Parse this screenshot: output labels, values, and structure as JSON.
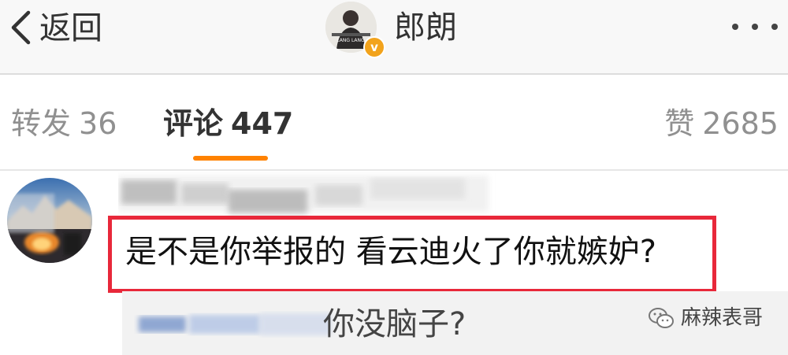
{
  "navbar": {
    "back_label": "返回",
    "profile_name": "郎朗",
    "avatar_caption": "LANG LANG",
    "verified_mark": "v",
    "icons": {
      "back": "chevron-left-icon",
      "more": "more-dots-icon",
      "verified": "verified-badge-icon"
    }
  },
  "tabs": {
    "repost": {
      "label": "转发",
      "count": "36"
    },
    "comments": {
      "label": "评论",
      "count": "447",
      "active": true
    },
    "likes": {
      "label": "赞",
      "count": "2685"
    }
  },
  "comment": {
    "text": "是不是你举报的 看云迪火了你就嫉妒?",
    "highlight_color": "#e8283a"
  },
  "reply": {
    "text": "你没脑子?"
  },
  "watermark": {
    "text": "麻辣表哥",
    "icon": "wechat-icon"
  },
  "colors": {
    "accent": "#ff8200",
    "highlight": "#e8283a",
    "verified": "#f2a31c"
  }
}
